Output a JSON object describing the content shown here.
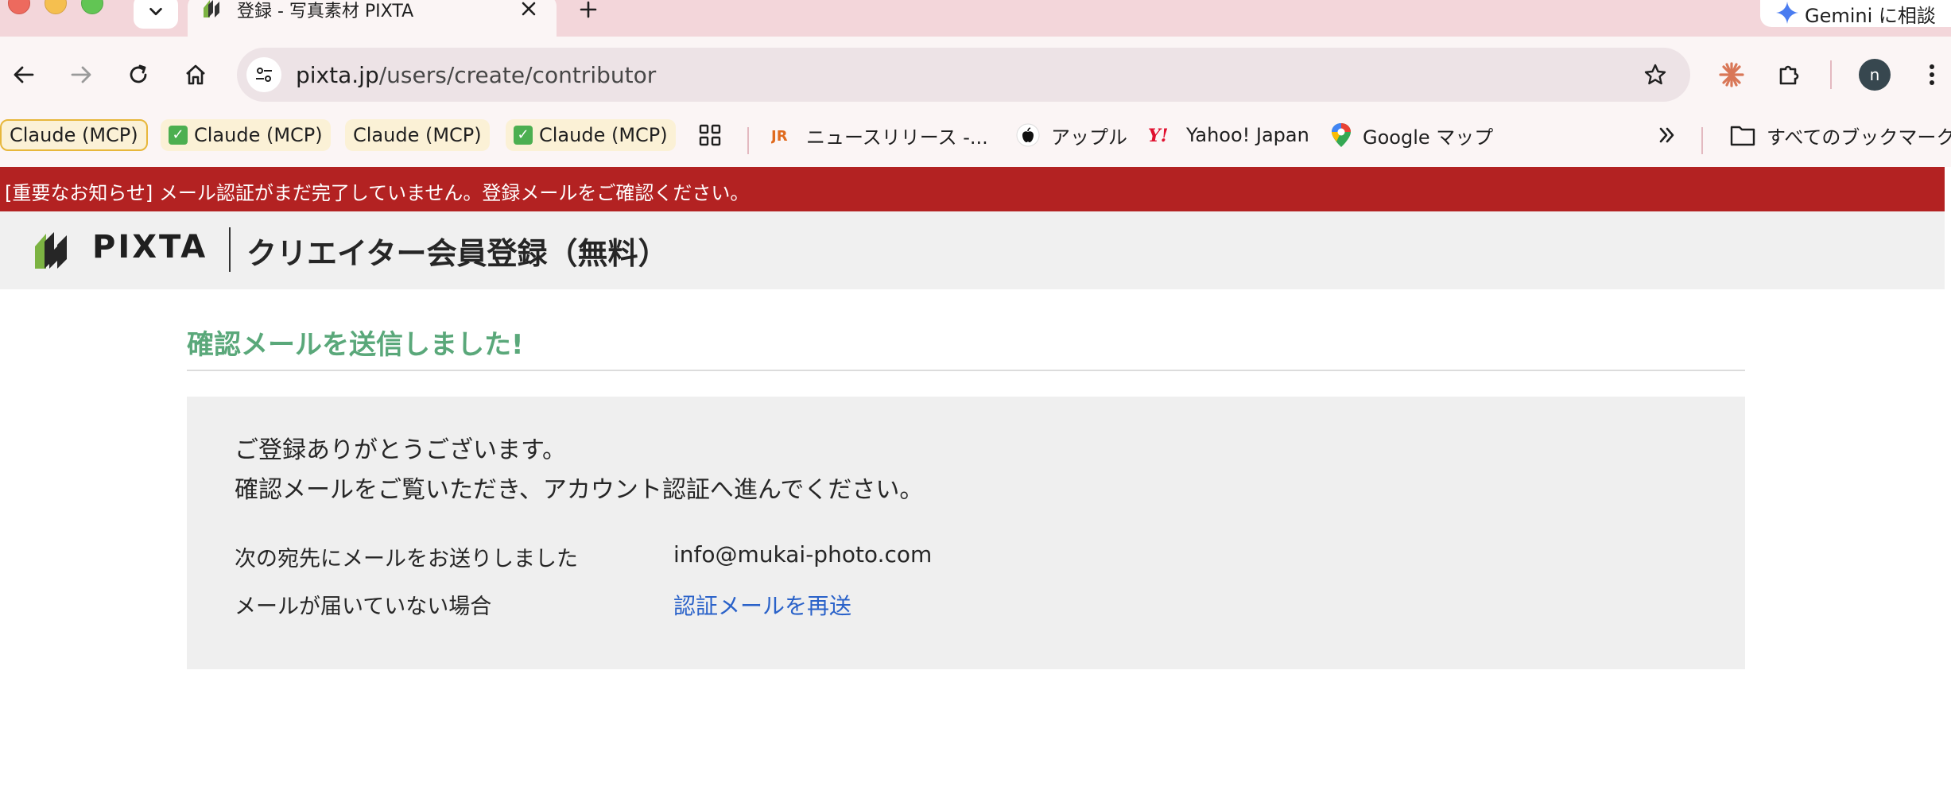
{
  "browser": {
    "tab": {
      "title": "登録 - 写真素材 PIXTA"
    },
    "gemini_button_label": "Gemini に相談",
    "address_bar": {
      "host": "pixta.jp",
      "path": "/users/create/contributor"
    },
    "profile_initial": "n",
    "bookmarks": [
      {
        "label": "Claude (MCP)",
        "style": "outlined"
      },
      {
        "label": "Claude (MCP)",
        "style": "checked"
      },
      {
        "label": "Claude (MCP)",
        "style": "plain"
      },
      {
        "label": "Claude (MCP)",
        "style": "checked"
      },
      {
        "label": "ニュースリリース -..."
      },
      {
        "label": "アップル"
      },
      {
        "label": "Yahoo! Japan"
      },
      {
        "label": "Google マップ"
      }
    ],
    "all_bookmarks_label": "すべてのブックマーク"
  },
  "notice": {
    "text": "[重要なお知らせ] メール認証がまだ完了していません。登録メールをご確認ください。",
    "color": "#b32222"
  },
  "header": {
    "logo_text": "PIXTA",
    "page_heading": "クリエイター会員登録（無料）"
  },
  "main": {
    "title": "確認メールを送信しました!",
    "title_color": "#5aa87a",
    "message_line1": "ご登録ありがとうございます。",
    "message_line2": "確認メールをご覧いただき、アカウント認証へ進んでください。",
    "rows": [
      {
        "label": "次の宛先にメールをお送りしました",
        "value": "info@mukai-photo.com"
      },
      {
        "label": "メールが届いていない場合",
        "value": "認証メールを再送"
      }
    ],
    "link_color": "#2a62c9"
  }
}
